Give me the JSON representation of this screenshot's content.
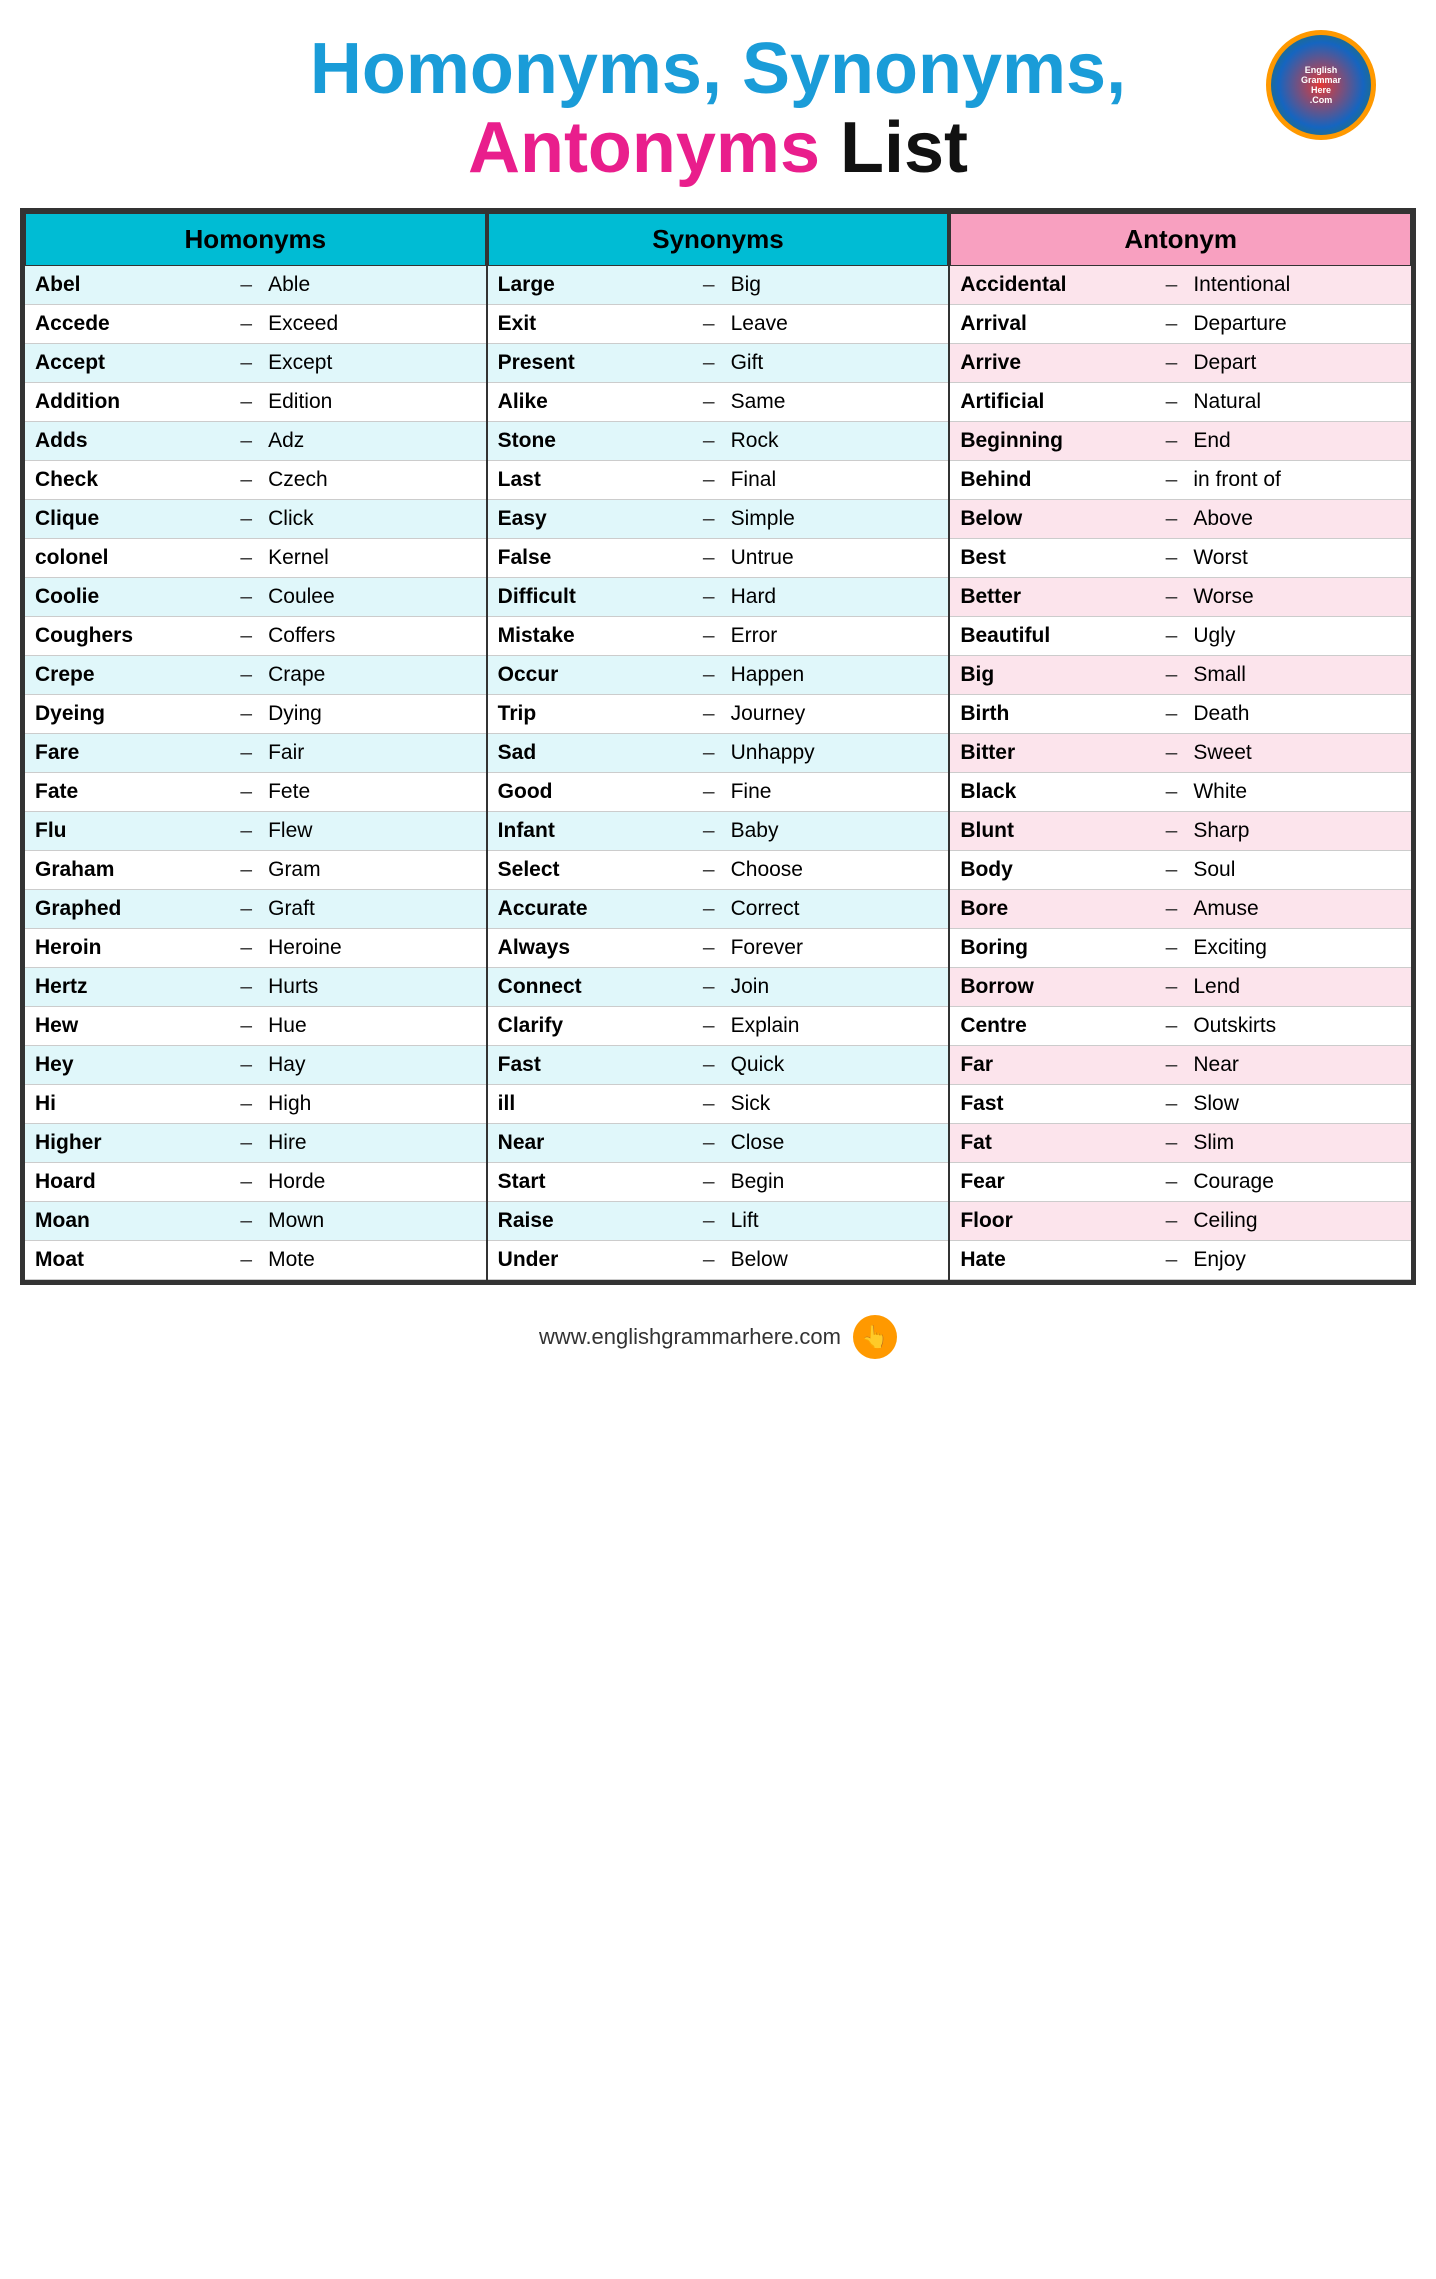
{
  "title": {
    "line1_part1": "Homonyms,",
    "line1_part2": " Synonyms,",
    "line2_part1": "Antonyms",
    "line2_part2": " List"
  },
  "homonyms": {
    "header": "Homonyms",
    "rows": [
      {
        "word": "Abel",
        "dash": "–",
        "meaning": "Able"
      },
      {
        "word": "Accede",
        "dash": "–",
        "meaning": "Exceed"
      },
      {
        "word": "Accept",
        "dash": "–",
        "meaning": "Except"
      },
      {
        "word": "Addition",
        "dash": "–",
        "meaning": "Edition"
      },
      {
        "word": "Adds",
        "dash": "–",
        "meaning": "Adz"
      },
      {
        "word": "Check",
        "dash": "–",
        "meaning": "Czech"
      },
      {
        "word": "Clique",
        "dash": "–",
        "meaning": "Click"
      },
      {
        "word": "colonel",
        "dash": "–",
        "meaning": "Kernel"
      },
      {
        "word": "Coolie",
        "dash": "–",
        "meaning": "Coulee"
      },
      {
        "word": "Coughers",
        "dash": "–",
        "meaning": "Coffers"
      },
      {
        "word": "Crepe",
        "dash": "–",
        "meaning": "Crape"
      },
      {
        "word": "Dyeing",
        "dash": "–",
        "meaning": "Dying"
      },
      {
        "word": "Fare",
        "dash": "–",
        "meaning": "Fair"
      },
      {
        "word": "Fate",
        "dash": "–",
        "meaning": "Fete"
      },
      {
        "word": "Flu",
        "dash": "–",
        "meaning": "Flew"
      },
      {
        "word": "Graham",
        "dash": "–",
        "meaning": "Gram"
      },
      {
        "word": "Graphed",
        "dash": "–",
        "meaning": "Graft"
      },
      {
        "word": "Heroin",
        "dash": "–",
        "meaning": "Heroine"
      },
      {
        "word": "Hertz",
        "dash": "–",
        "meaning": "Hurts"
      },
      {
        "word": "Hew",
        "dash": "–",
        "meaning": "Hue"
      },
      {
        "word": "Hey",
        "dash": "–",
        "meaning": "Hay"
      },
      {
        "word": "Hi",
        "dash": "–",
        "meaning": "High"
      },
      {
        "word": "Higher",
        "dash": "–",
        "meaning": "Hire"
      },
      {
        "word": "Hoard",
        "dash": "–",
        "meaning": "Horde"
      },
      {
        "word": "Moan",
        "dash": "–",
        "meaning": "Mown"
      },
      {
        "word": "Moat",
        "dash": "–",
        "meaning": "Mote"
      }
    ]
  },
  "synonyms": {
    "header": "Synonyms",
    "rows": [
      {
        "word": "Large",
        "dash": "–",
        "meaning": "Big"
      },
      {
        "word": "Exit",
        "dash": "–",
        "meaning": "Leave"
      },
      {
        "word": "Present",
        "dash": "–",
        "meaning": "Gift"
      },
      {
        "word": "Alike",
        "dash": "–",
        "meaning": "Same"
      },
      {
        "word": "Stone",
        "dash": "–",
        "meaning": "Rock"
      },
      {
        "word": "Last",
        "dash": "–",
        "meaning": "Final"
      },
      {
        "word": "Easy",
        "dash": "–",
        "meaning": "Simple"
      },
      {
        "word": "False",
        "dash": "–",
        "meaning": "Untrue"
      },
      {
        "word": "Difficult",
        "dash": "–",
        "meaning": "Hard"
      },
      {
        "word": "Mistake",
        "dash": "–",
        "meaning": "Error"
      },
      {
        "word": "Occur",
        "dash": "–",
        "meaning": "Happen"
      },
      {
        "word": "Trip",
        "dash": "–",
        "meaning": "Journey"
      },
      {
        "word": "Sad",
        "dash": "–",
        "meaning": "Unhappy"
      },
      {
        "word": "Good",
        "dash": "–",
        "meaning": "Fine"
      },
      {
        "word": "Infant",
        "dash": "–",
        "meaning": "Baby"
      },
      {
        "word": "Select",
        "dash": "–",
        "meaning": "Choose"
      },
      {
        "word": "Accurate",
        "dash": "–",
        "meaning": "Correct"
      },
      {
        "word": "Always",
        "dash": "–",
        "meaning": "Forever"
      },
      {
        "word": "Connect",
        "dash": "–",
        "meaning": "Join"
      },
      {
        "word": "Clarify",
        "dash": "–",
        "meaning": "Explain"
      },
      {
        "word": "Fast",
        "dash": "–",
        "meaning": "Quick"
      },
      {
        "word": "ill",
        "dash": "–",
        "meaning": "Sick"
      },
      {
        "word": "Near",
        "dash": "–",
        "meaning": "Close"
      },
      {
        "word": "Start",
        "dash": "–",
        "meaning": "Begin"
      },
      {
        "word": "Raise",
        "dash": "–",
        "meaning": "Lift"
      },
      {
        "word": "Under",
        "dash": "–",
        "meaning": "Below"
      }
    ]
  },
  "antonyms": {
    "header": "Antonym",
    "rows": [
      {
        "word": "Accidental",
        "dash": "–",
        "meaning": "Intentional"
      },
      {
        "word": "Arrival",
        "dash": "–",
        "meaning": "Departure"
      },
      {
        "word": "Arrive",
        "dash": "–",
        "meaning": "Depart"
      },
      {
        "word": "Artificial",
        "dash": "–",
        "meaning": "Natural"
      },
      {
        "word": "Beginning",
        "dash": "–",
        "meaning": "End"
      },
      {
        "word": "Behind",
        "dash": "–",
        "meaning": "in front of"
      },
      {
        "word": "Below",
        "dash": "–",
        "meaning": "Above"
      },
      {
        "word": "Best",
        "dash": "–",
        "meaning": "Worst"
      },
      {
        "word": "Better",
        "dash": "–",
        "meaning": "Worse"
      },
      {
        "word": "Beautiful",
        "dash": "–",
        "meaning": "Ugly"
      },
      {
        "word": "Big",
        "dash": "–",
        "meaning": "Small"
      },
      {
        "word": "Birth",
        "dash": "–",
        "meaning": "Death"
      },
      {
        "word": "Bitter",
        "dash": "–",
        "meaning": "Sweet"
      },
      {
        "word": "Black",
        "dash": "–",
        "meaning": "White"
      },
      {
        "word": "Blunt",
        "dash": "–",
        "meaning": "Sharp"
      },
      {
        "word": "Body",
        "dash": "–",
        "meaning": "Soul"
      },
      {
        "word": "Bore",
        "dash": "–",
        "meaning": "Amuse"
      },
      {
        "word": "Boring",
        "dash": "–",
        "meaning": "Exciting"
      },
      {
        "word": "Borrow",
        "dash": "–",
        "meaning": "Lend"
      },
      {
        "word": "Centre",
        "dash": "–",
        "meaning": "Outskirts"
      },
      {
        "word": "Far",
        "dash": "–",
        "meaning": "Near"
      },
      {
        "word": "Fast",
        "dash": "–",
        "meaning": "Slow"
      },
      {
        "word": "Fat",
        "dash": "–",
        "meaning": "Slim"
      },
      {
        "word": "Fear",
        "dash": "–",
        "meaning": "Courage"
      },
      {
        "word": "Floor",
        "dash": "–",
        "meaning": "Ceiling"
      },
      {
        "word": "Hate",
        "dash": "–",
        "meaning": "Enjoy"
      }
    ]
  },
  "footer": {
    "url": "www.englishgrammarhere.com"
  }
}
